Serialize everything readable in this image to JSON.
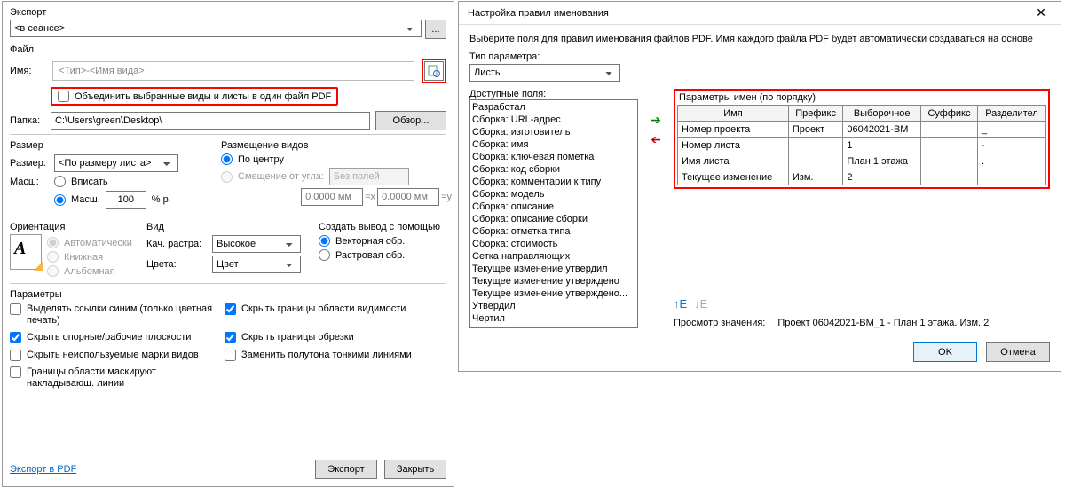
{
  "left": {
    "export_label": "Экспорт",
    "export_value": "<в сеансе>",
    "dots": "...",
    "file_label": "Файл",
    "name_label": "Имя:",
    "name_placeholder": "<Тип>-<Имя вида>",
    "merge_label": "Объединить выбранные виды и листы в один файл PDF",
    "folder_label": "Папка:",
    "folder_value": "C:\\Users\\green\\Desktop\\",
    "browse": "Обзор...",
    "size_label": "Размер",
    "size_field": "Размер:",
    "size_value": "<По размеру листа>",
    "scale_label": "Масш:",
    "fit_label": "Вписать",
    "scale_opt": "Масш.",
    "percent": "% р.",
    "scale_value": "100",
    "placement_label": "Размещение видов",
    "center_label": "По центру",
    "offset_label": "Смещение от угла:",
    "margin_value": "Без полей",
    "coord_x": "0.0000 мм",
    "coord_y": "0.0000 мм",
    "eq_x": "=x",
    "eq_y": "=y",
    "orient_label": "Ориентация",
    "auto": "Автоматически",
    "portrait": "Книжная",
    "landscape": "Альбомная",
    "view_label": "Вид",
    "raster_q": "Кач. растра:",
    "raster_value": "Высокое",
    "colors_label": "Цвета:",
    "colors_value": "Цвет",
    "output_label": "Создать вывод с помощью",
    "vector": "Векторная обр.",
    "raster": "Растровая обр.",
    "params_label": "Параметры",
    "p1": "Выделять ссылки синим (только цветная печать)",
    "p2": "Скрыть опорные/рабочие плоскости",
    "p3": "Скрыть неиспользуемые марки видов",
    "p4": "Границы области маскируют накладывающ. линии",
    "p5": "Скрыть границы области видимости",
    "p6": "Скрыть границы обрезки",
    "p7": "Заменить полутона тонкими линиями",
    "help_link": "Экспорт в PDF",
    "export_btn": "Экспорт",
    "close_btn": "Закрыть"
  },
  "right": {
    "title": "Настройка правил именования",
    "desc": "Выберите поля для правил именования файлов PDF. Имя каждого файла PDF будет автоматически создаваться на основе",
    "type_label": "Тип параметра:",
    "type_value": "Листы",
    "avail_label": "Доступные поля:",
    "list": [
      "Разработал",
      "Сборка: URL-адрес",
      "Сборка: изготовитель",
      "Сборка: имя",
      "Сборка: ключевая пометка",
      "Сборка: код сборки",
      "Сборка: комментарии к типу",
      "Сборка: модель",
      "Сборка: описание",
      "Сборка: описание сборки",
      "Сборка: отметка типа",
      "Сборка: стоимость",
      "Сетка направляющих",
      "Текущее изменение утвердил",
      "Текущее изменение утверждено",
      "Текущее изменение утверждено...",
      "Утвердил",
      "Чертил"
    ],
    "table_title": "Параметры имен (по порядку)",
    "cols": {
      "name": "Имя",
      "prefix": "Префикс",
      "sample": "Выборочное",
      "suffix": "Суффикс",
      "sep": "Разделител"
    },
    "rows": [
      {
        "name": "Номер проекта",
        "prefix": "Проект",
        "sample": "06042021-BM",
        "suffix": "",
        "sep": "_"
      },
      {
        "name": "Номер листа",
        "prefix": "",
        "sample": "1",
        "suffix": "",
        "sep": "-"
      },
      {
        "name": "Имя листа",
        "prefix": "",
        "sample": "План 1 этажа",
        "suffix": "",
        "sep": "."
      },
      {
        "name": "Текущее изменение",
        "prefix": "Изм.",
        "sample": "2",
        "suffix": "",
        "sep": ""
      }
    ],
    "preview_label": "Просмотр значения:",
    "preview_value": "Проект 06042021-BM_1 - План 1 этажа. Изм. 2",
    "ok": "OK",
    "cancel": "Отмена"
  }
}
